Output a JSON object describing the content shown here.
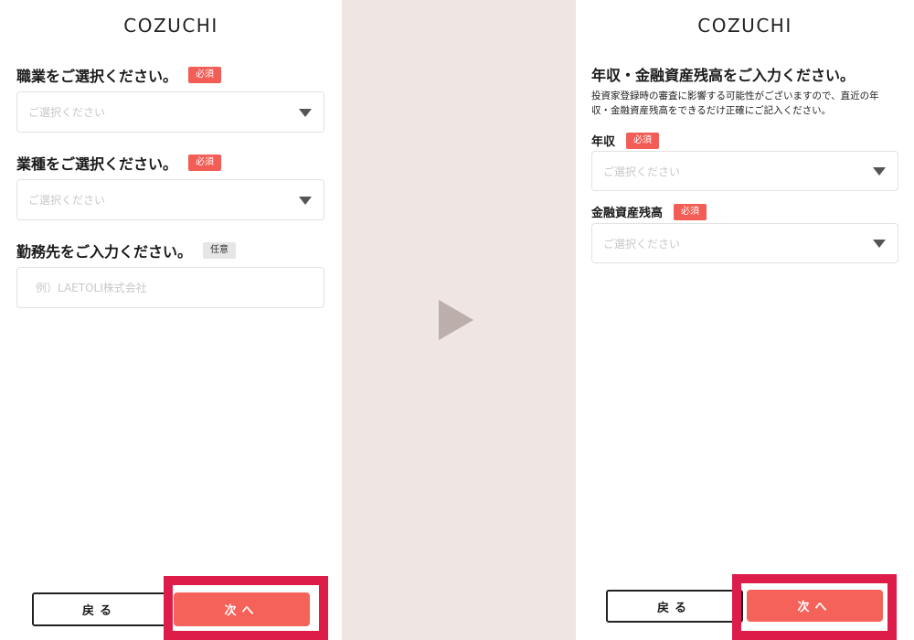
{
  "brand": "COZUCHI",
  "left": {
    "fields": [
      {
        "label": "職業をご選択ください。",
        "badge": "必須",
        "placeholder": "ご選択ください"
      },
      {
        "label": "業種をご選択ください。",
        "badge": "必須",
        "placeholder": "ご選択ください"
      },
      {
        "label": "勤務先をご入力ください。",
        "badge": "任意",
        "placeholder": "例）LAETOLI株式会社"
      }
    ],
    "back_label": "戻る",
    "next_label": "次へ"
  },
  "right": {
    "heading": "年収・金融資産残高をご入力ください。",
    "description_line1": "投資家登録時の審査に影響する可能性がございますので、直近の年",
    "description_line2": "収・金融資産残高をできるだけ正確にご記入ください。",
    "fields": [
      {
        "label": "年収",
        "badge": "必須",
        "placeholder": "ご選択ください"
      },
      {
        "label": "金融資産残高",
        "badge": "必須",
        "placeholder": "ご選択ください"
      }
    ],
    "back_label": "戻る",
    "next_label": "次へ"
  },
  "colors": {
    "accent": "#f5625a",
    "highlight": "#dd1c4a",
    "divider_bg": "#efe5e2",
    "arrow": "#bcaeaa"
  }
}
